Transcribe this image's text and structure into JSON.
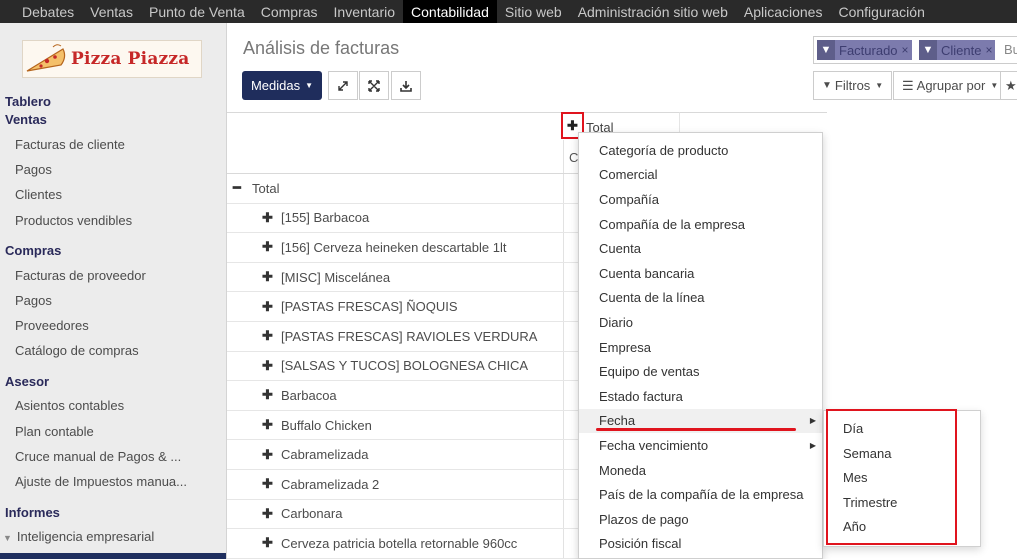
{
  "topnav": {
    "items": [
      "Debates",
      "Ventas",
      "Punto de Venta",
      "Compras",
      "Inventario",
      "Contabilidad",
      "Sitio web",
      "Administración sitio web",
      "Aplicaciones",
      "Configuración"
    ],
    "active_index": 5
  },
  "logo": {
    "text": "Pizza Piazza"
  },
  "sidebar": {
    "tablero": "Tablero",
    "ventas": {
      "title": "Ventas",
      "items": [
        "Facturas de cliente",
        "Pagos",
        "Clientes",
        "Productos vendibles"
      ]
    },
    "compras": {
      "title": "Compras",
      "items": [
        "Facturas de proveedor",
        "Pagos",
        "Proveedores",
        "Catálogo de compras"
      ]
    },
    "asesor": {
      "title": "Asesor",
      "items": [
        "Asientos contables",
        "Plan contable",
        "Cruce manual de Pagos & ...",
        "Ajuste de Impuestos manua..."
      ]
    },
    "informes": {
      "title": "Informes",
      "items": [
        "Inteligencia empresarial"
      ]
    }
  },
  "page": {
    "title": "Análisis de facturas"
  },
  "toolbar": {
    "medidas_label": "Medidas",
    "filtros_label": "Filtros",
    "agrupar_label": "Agrupar por"
  },
  "search": {
    "facets": [
      "Facturado",
      "Cliente"
    ],
    "partial_text": "Bu"
  },
  "pivot": {
    "col_header": "Total",
    "col_sub": "C",
    "row_total": "Total",
    "rows": [
      "[155] Barbacoa",
      "[156] Cerveza heineken descartable 1lt",
      "[MISC] Miscelánea",
      "[PASTAS FRESCAS] ÑOQUIS",
      "[PASTAS FRESCAS] RAVIOLES VERDURA",
      "[SALSAS Y TUCOS] BOLOGNESA CHICA",
      "Barbacoa",
      "Buffalo Chicken",
      "Cabramelizada",
      "Cabramelizada 2",
      "Carbonara",
      "Cerveza patricia botella retornable 960cc"
    ]
  },
  "groupby_menu": {
    "items": [
      "Categoría de producto",
      "Comercial",
      "Compañía",
      "Compañía de la empresa",
      "Cuenta",
      "Cuenta bancaria",
      "Cuenta de la línea",
      "Diario",
      "Empresa",
      "Equipo de ventas",
      "Estado factura",
      "Fecha",
      "Fecha vencimiento",
      "Moneda",
      "País de la compañía de la empresa",
      "Plazos de pago",
      "Posición fiscal"
    ],
    "hover_item": "Fecha"
  },
  "date_submenu": {
    "items": [
      "Día",
      "Semana",
      "Mes",
      "Trimestre",
      "Año"
    ]
  },
  "colors": {
    "topbar": "#2a2a2a",
    "primary_button": "#1f2d5c",
    "facet": "#7c7bad",
    "highlight_red": "#e0141e"
  }
}
